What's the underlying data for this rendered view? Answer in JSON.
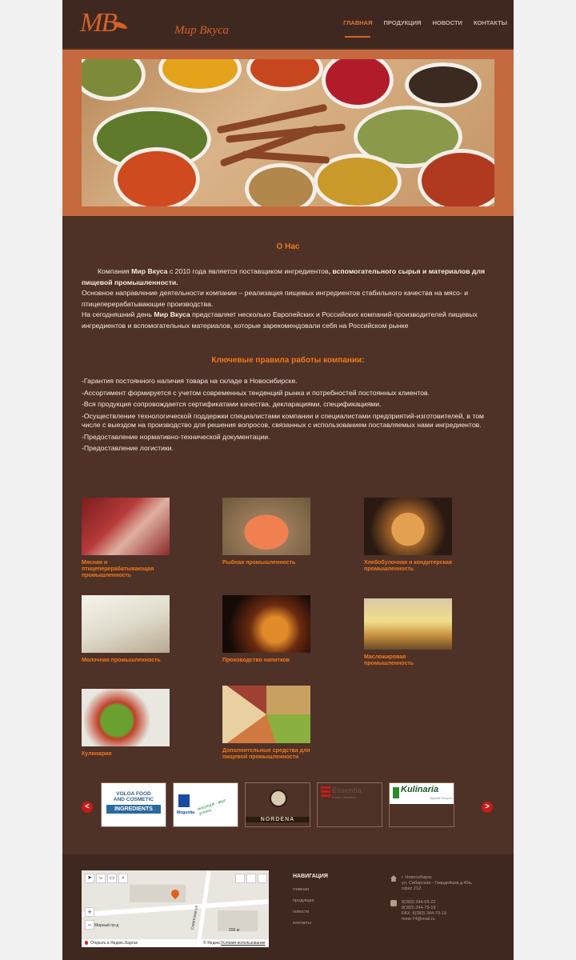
{
  "header": {
    "logo_mark": "МВ",
    "logo_text": "Мир Вкуса",
    "nav": [
      {
        "label": "ГЛАВНАЯ",
        "active": true
      },
      {
        "label": "ПРОДУКЦИЯ",
        "active": false
      },
      {
        "label": "НОВОСТИ",
        "active": false
      },
      {
        "label": "КОНТАКТЫ",
        "active": false
      }
    ]
  },
  "about": {
    "title": "О Нас",
    "p1_pre": "Компания ",
    "p1_brand": "Мир Вкуса",
    "p1_mid": " с 2010 года является поставщиком ингредиентов",
    "p1_bold": ", вспомогательного сырья и материалов для пищевой промышленности.",
    "p2": "Основное направление деятельности компании – реализация пищевых ингредиентов стабильного качества на мясо- и птицеперерабатывающие производства.",
    "p3_pre": "На сегодняшний день ",
    "p3_brand": "Мир Вкуса",
    "p3_rest": " представляет несколько Европейских и Российских компаний-производителей пищевых ингредиентов и вспомогательных материалов, которые зарекомендовали себя на Российском рынке"
  },
  "rules": {
    "title": "Ключевые правила работы компании:",
    "items": [
      "-Гарантия постоянного наличия товара на складе в Новосибирске.",
      "-Ассортимент формируется с учетом современных тенденций рынка и потребностей постоянных клиентов.",
      "-Вся продукция сопровождается сертификатами качества, декларациями, спецификациями.",
      "-Осуществление технологической поддержки специалистами компании и специалистами предприятий-изготовителей, в том числе с выездом на производство для решения вопросов, связанных с использованием поставляемых нами ингредиентов.",
      "-Предоставление нормативно-технической документации.",
      "-Предоставление логистики."
    ]
  },
  "categories": [
    {
      "label": "Мясная и птицеперерабатывающая промышленность"
    },
    {
      "label": "Рыбная промышленность"
    },
    {
      "label": "Хлебобулочная и кондитерская промышленность"
    },
    {
      "label": "Молочная промышленность"
    },
    {
      "label": "Производство напитков"
    },
    {
      "label": "Масложировая промышленность"
    },
    {
      "label": "Кулинария"
    },
    {
      "label": "Дополнительные средства для пищевой промышленности"
    }
  ],
  "partners": {
    "prev": "<",
    "next": ">",
    "items": [
      {
        "line1": "VOLGA FOOD",
        "line2": "AND COSMETIC",
        "line3": "INGREDIENTS"
      },
      {
        "line1": "Mogunita",
        "line2": "могунция - вкус успеха"
      },
      {
        "line1": "NORDENA"
      },
      {
        "line1": "Essentia",
        "line2": "Protein Solutions"
      },
      {
        "line1": "Kulinaria",
        "line2": "Special Recipes"
      }
    ]
  },
  "footer": {
    "map": {
      "street1": "Мирный пр-д",
      "street2": "Советская ул",
      "scale": "200 м",
      "open_link": "Открыть в Яндекс.Картах",
      "attribution": "© Яндекс",
      "terms": "Условия использования"
    },
    "nav_title": "НАВИГАЦИЯ",
    "nav_links": [
      "главная",
      "продукция",
      "новости",
      "контакты"
    ],
    "address": [
      "г. Новосибирск",
      "ул. Сибирская - Гвардейцев,д.49а,",
      "офис 212."
    ],
    "phones": [
      "8(383) 344-65-22",
      "8(383) 344-79-19",
      "FAX: 8(383) 344-79-19",
      "mew-74@mail.ru"
    ]
  }
}
